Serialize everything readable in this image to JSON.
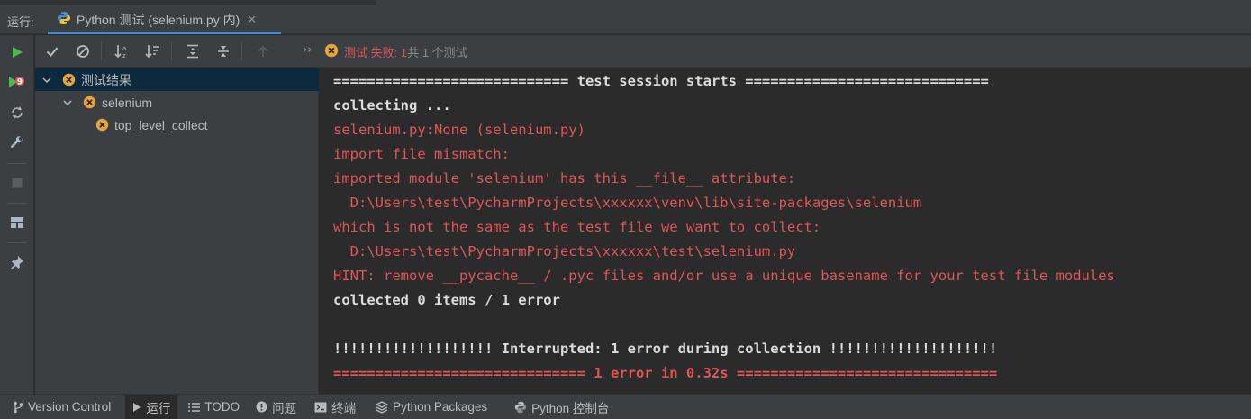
{
  "run_panel": {
    "label": "运行:",
    "tab_title": "Python 测试 (selenium.py 内)",
    "tab_close": "✕"
  },
  "status": {
    "failed_text": "测试 失败: 1",
    "total_text": "共 1 个测试"
  },
  "tree": {
    "items": [
      {
        "label": "测试结果",
        "level": 0,
        "expanded": true,
        "selected": true
      },
      {
        "label": "selenium",
        "level": 1,
        "expanded": true,
        "selected": false
      },
      {
        "label": "top_level_collect",
        "level": 2,
        "expanded": false,
        "selected": false
      }
    ]
  },
  "console": {
    "lines": [
      {
        "text": "============================ test session starts =============================",
        "style": "bold"
      },
      {
        "text": "collecting ...",
        "style": "bold"
      },
      {
        "text": "selenium.py:None (selenium.py)",
        "style": "err"
      },
      {
        "text": "import file mismatch:",
        "style": "err"
      },
      {
        "text": "imported module 'selenium' has this __file__ attribute:",
        "style": "err"
      },
      {
        "text": "  D:\\Users\\test\\PycharmProjects\\xxxxxx\\venv\\lib\\site-packages\\selenium",
        "style": "err"
      },
      {
        "text": "which is not the same as the test file we want to collect:",
        "style": "err"
      },
      {
        "text": "  D:\\Users\\test\\PycharmProjects\\xxxxxx\\test\\selenium.py",
        "style": "err"
      },
      {
        "text": "HINT: remove __pycache__ / .pyc files and/or use a unique basename for your test file modules",
        "style": "err"
      },
      {
        "text": "collected 0 items / 1 error",
        "style": "bold"
      },
      {
        "text": "",
        "style": "bold"
      },
      {
        "text": "!!!!!!!!!!!!!!!!!!! Interrupted: 1 error during collection !!!!!!!!!!!!!!!!!!!!",
        "style": "bold"
      },
      {
        "text": "============================== 1 error in 0.32s ===============================",
        "style": "errbold"
      }
    ]
  },
  "bottom_tabs": [
    {
      "label": "Version Control",
      "icon": "branch-icon",
      "active": false
    },
    {
      "label": "运行",
      "icon": "play-icon",
      "active": true
    },
    {
      "label": "TODO",
      "icon": "list-icon",
      "active": false
    },
    {
      "label": "问题",
      "icon": "warning-icon",
      "active": false
    },
    {
      "label": "终端",
      "icon": "terminal-icon",
      "active": false
    },
    {
      "label": "Python Packages",
      "icon": "packages-icon",
      "active": false
    },
    {
      "label": "Python 控制台",
      "icon": "python-icon",
      "active": false
    }
  ],
  "colors": {
    "background": "#2b2b2b",
    "panel": "#3c3f41",
    "error": "#e05555",
    "selection": "#0d293e",
    "run_green": "#4eb84e",
    "fail_orange": "#e8a33d"
  }
}
